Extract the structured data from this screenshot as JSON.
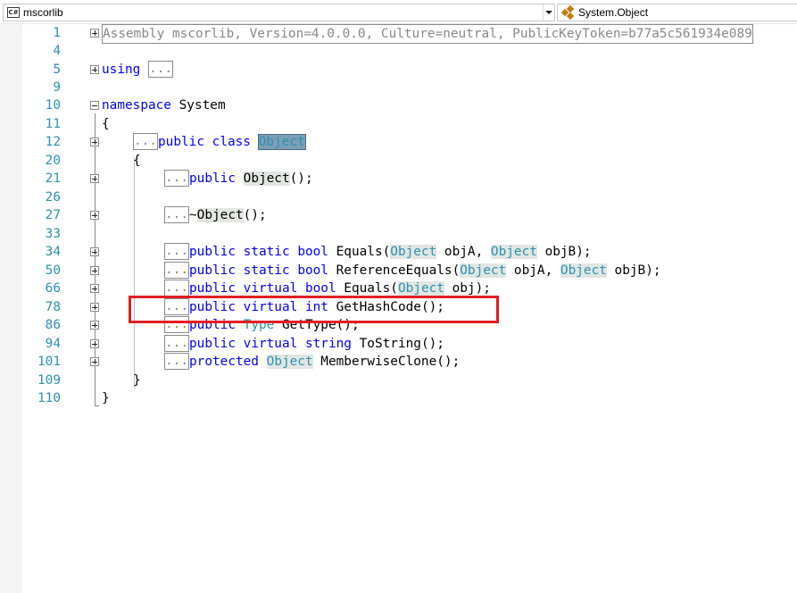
{
  "navigation": {
    "assembly_combo": {
      "icon": "csharp-file-icon",
      "label": "mscorlib"
    },
    "member_combo": {
      "icon": "class-icon",
      "label": "System.Object"
    }
  },
  "code_lines": [
    {
      "num": "1"
    },
    {
      "num": "4"
    },
    {
      "num": "5"
    },
    {
      "num": "9"
    },
    {
      "num": "10"
    },
    {
      "num": "11"
    },
    {
      "num": "12"
    },
    {
      "num": "20"
    },
    {
      "num": "21"
    },
    {
      "num": "26"
    },
    {
      "num": "27"
    },
    {
      "num": "33"
    },
    {
      "num": "34"
    },
    {
      "num": "50"
    },
    {
      "num": "66"
    },
    {
      "num": "78"
    },
    {
      "num": "86"
    },
    {
      "num": "94"
    },
    {
      "num": "101"
    },
    {
      "num": "109"
    },
    {
      "num": "110"
    }
  ],
  "code": {
    "assembly_header": "Assembly mscorlib, Version=4.0.0.0, Culture=neutral, PublicKeyToken=b77a5c561934e089",
    "using_kw": "using",
    "ellipsis": "...",
    "namespace_kw": "namespace",
    "namespace_name": " System",
    "open_brace": "{",
    "close_brace": "}",
    "public_kw": "public",
    "protected_kw": "protected",
    "class_kw": "class",
    "static_kw": "static",
    "virtual_kw": "virtual",
    "bool_kw": "bool",
    "int_kw": "int",
    "string_kw": "string",
    "object_type": "Object",
    "type_type": "Type",
    "ctor_parens": "();",
    "finalizer_tilde": "~",
    "equals_open": " Equals(",
    "refequals_open": " ReferenceEquals(",
    "obj_a": " objA, ",
    "obj_b": " objB);",
    "obj_single": " obj);",
    "gethashcode": " GetHashCode();",
    "gettype": " GetType();",
    "tostring": " ToString();",
    "memberwiseclone": " MemberwiseClone();"
  },
  "annotation": {
    "color": "#e31e24",
    "target_line": "78"
  },
  "colors": {
    "keyword": "#0000ff",
    "type": "#2b91af",
    "line_number": "#2b91af",
    "reference_bg": "#e1e6e3",
    "selection_bg": "#7c9eb7"
  }
}
